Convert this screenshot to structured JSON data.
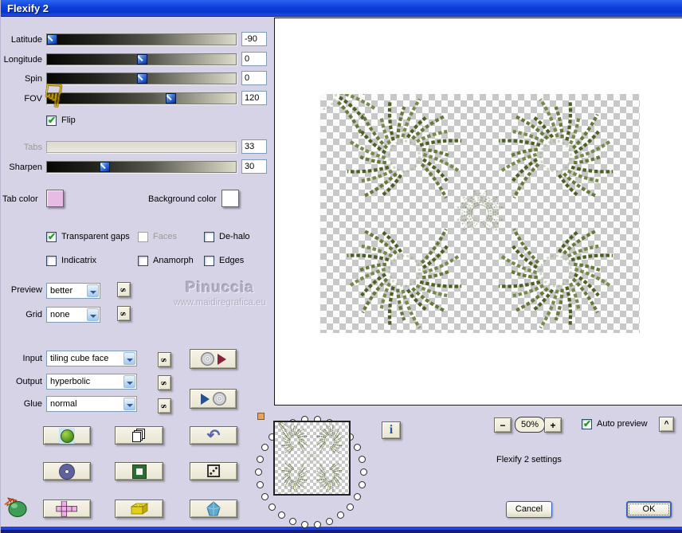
{
  "window": {
    "title": "Flexify 2"
  },
  "sliders": [
    {
      "label": "Latitude",
      "value": "-90",
      "pct": 0,
      "disabled": false
    },
    {
      "label": "Longitude",
      "value": "0",
      "pct": 50,
      "disabled": false
    },
    {
      "label": "Spin",
      "value": "0",
      "pct": 50,
      "disabled": false
    },
    {
      "label": "FOV",
      "value": "120",
      "pct": 66,
      "disabled": false
    },
    {
      "label": "Tabs",
      "value": "33",
      "pct": 0,
      "disabled": true
    },
    {
      "label": "Sharpen",
      "value": "30",
      "pct": 29,
      "disabled": false
    }
  ],
  "flip": {
    "label": "Flip",
    "checked": true
  },
  "color_pickers": {
    "tab_label": "Tab color",
    "tab_color": "#E6BCE4",
    "background_label": "Background color",
    "background_color": "#FFFFFF"
  },
  "checkboxes": [
    {
      "label": "Transparent gaps",
      "checked": true,
      "disabled": false
    },
    {
      "label": "Faces",
      "checked": false,
      "disabled": true
    },
    {
      "label": "De-halo",
      "checked": false,
      "disabled": false
    },
    {
      "label": "Indicatrix",
      "checked": false,
      "disabled": false
    },
    {
      "label": "Anamorph",
      "checked": false,
      "disabled": false
    },
    {
      "label": "Edges",
      "checked": false,
      "disabled": false
    }
  ],
  "dropdowns": {
    "preview": {
      "label": "Preview",
      "value": "better"
    },
    "grid": {
      "label": "Grid",
      "value": "none"
    },
    "input": {
      "label": "Input",
      "value": "tiling cube face"
    },
    "output": {
      "label": "Output",
      "value": "hyperbolic"
    },
    "glue": {
      "label": "Glue",
      "value": "normal"
    }
  },
  "s_button_label": "s",
  "watermark": {
    "name": "Pinuccia",
    "url": "www.maidiregrafica.eu"
  },
  "zoom_controls": {
    "minus": "−",
    "value": "50%",
    "plus": "+",
    "expand": "^"
  },
  "auto_preview": {
    "label": "Auto preview",
    "checked": true
  },
  "info_button_label": "i",
  "settings_text": "Flexify 2 settings",
  "action_buttons": {
    "cancel": "Cancel",
    "ok": "OK"
  },
  "accent_colors": {
    "title_bar": "#0F41DE",
    "dialog_bg": "#D6D3E7",
    "pattern_green": "#5F7334",
    "bottom_bar_blue": "#2143D8",
    "bottom_bar_dark": "#151C78"
  }
}
